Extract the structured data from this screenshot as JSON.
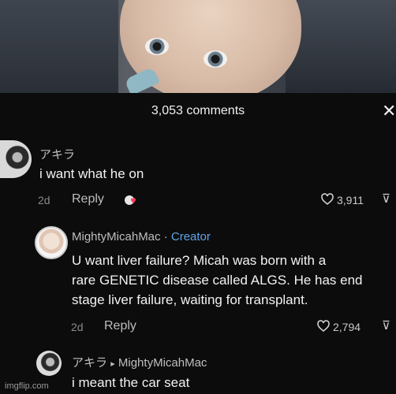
{
  "header": {
    "title": "3,053 comments",
    "close_glyph": "✕"
  },
  "comments": [
    {
      "user": "アキラ",
      "text_lines": [
        "i want what he on"
      ],
      "time": "2d",
      "reply": "Reply",
      "likes": "3,911"
    },
    {
      "user": "MightyMicahMac",
      "separator": " · ",
      "badge": "Creator",
      "text_lines": [
        "U want liver failure? Micah was born with a",
        "rare GENETIC disease called ALGS. He has end",
        "stage liver failure, waiting for transplant."
      ],
      "time": "2d",
      "reply": "Reply",
      "likes": "2,794"
    },
    {
      "user": "アキラ",
      "reply_arrow": "▸",
      "reply_to": "MightyMicahMac",
      "text_lines": [
        "i meant the car seat"
      ]
    }
  ],
  "watermark": "imgflip.com",
  "colors": {
    "creator": "#5ea5e8",
    "background": "#0c0c0c"
  }
}
